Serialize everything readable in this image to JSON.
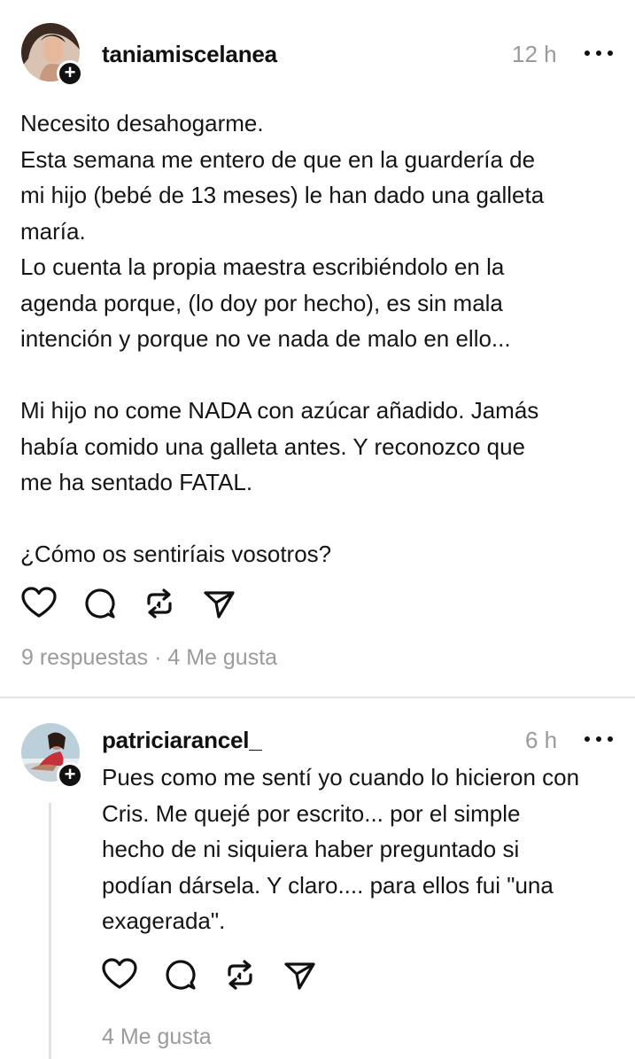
{
  "post": {
    "username": "taniamiscelanea",
    "time": "12 h",
    "text": "Necesito desahogarme.\nEsta semana me entero de que en la guardería de\nmi hijo (bebé de 13 meses) le han dado una galleta\nmaría.\nLo cuenta la propia maestra escribiéndolo en la\nagenda porque, (lo doy por hecho), es sin mala\nintención y porque no ve nada de malo en ello...\n\nMi hijo no come NADA con azúcar añadido. Jamás\nhabía comido una galleta antes. Y reconozco que\nme ha sentado FATAL.\n\n¿Cómo os sentiríais vosotros?",
    "meta": "9 respuestas · 4 Me gusta"
  },
  "reply": {
    "username": "patriciarancel_",
    "time": "6 h",
    "text": "Pues como me sentí yo cuando lo hicieron con\nCris. Me quejé por escrito... por el simple\nhecho de ni siquiera haber preguntado si\npodían dársela. Y claro.... para ellos fui \"una\nexagerada\".",
    "meta": "4 Me gusta"
  },
  "icons": [
    "heart-icon",
    "comment-icon",
    "repost-icon",
    "share-icon",
    "more-icon",
    "follow-plus-icon"
  ],
  "colors": {
    "text": "#111111",
    "muted": "#9a9a9a",
    "divider": "#e4e4e4"
  }
}
